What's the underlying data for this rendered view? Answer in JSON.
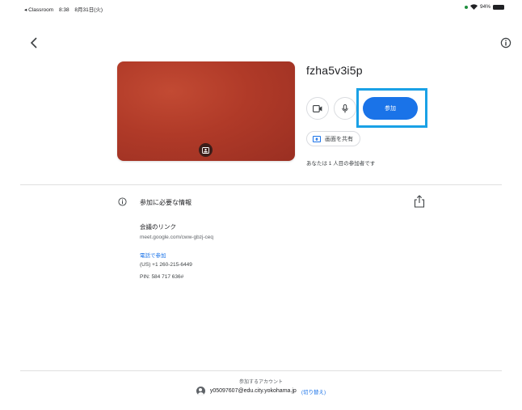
{
  "status_bar": {
    "back_app": "◂ Classroom",
    "time": "8:38",
    "date": "8月31日(火)",
    "battery": "94%"
  },
  "meeting": {
    "code": "fzha5v3i5p",
    "join_label": "参加",
    "present_label": "画面を共有",
    "participants_text": "あなたは 1 人目の参加者です"
  },
  "info": {
    "title": "参加に必要な情報",
    "link_label": "会議のリンク",
    "link_url": "meet.google.com/cww-gbzj-ceq",
    "phone_join_label": "電話で参加",
    "phone_number": "(US) +1 260-215-6449",
    "pin": "PIN: 584 717 636#"
  },
  "account": {
    "label": "参加するアカウント",
    "email": "y05097607@edu.city.yokohama.jp",
    "switch_label": "(切り替え)"
  },
  "colors": {
    "accent": "#1a73e8",
    "highlight": "#1aa1e6",
    "preview": "#b03a28"
  },
  "icons": [
    "back-arrow-icon",
    "info-icon",
    "camera-icon",
    "mic-icon",
    "present-screen-icon",
    "share-icon",
    "avatar-icon",
    "background-effects-icon",
    "wifi-icon",
    "battery-icon"
  ]
}
